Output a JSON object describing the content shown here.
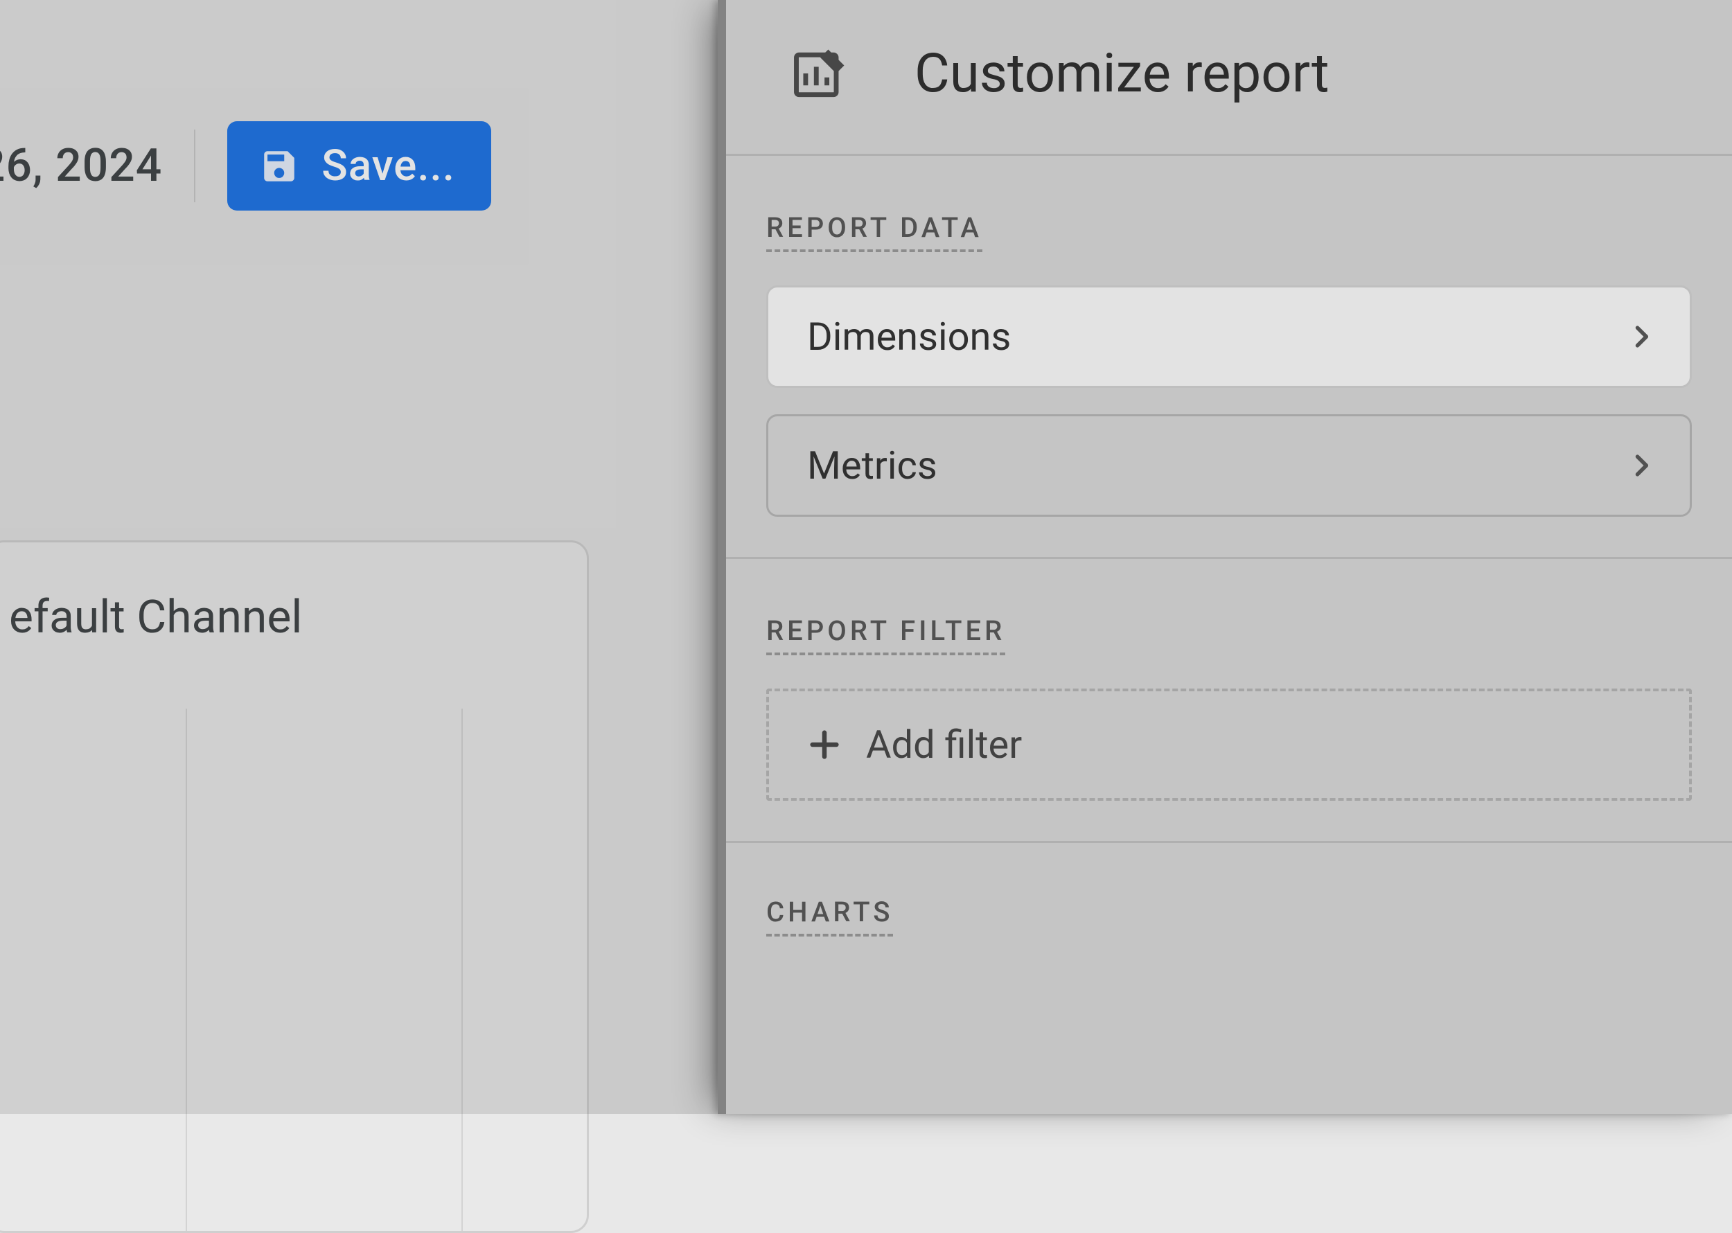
{
  "toolbar": {
    "date_fragment": "26, 2024",
    "save_label": "Save..."
  },
  "left_chart": {
    "title_fragment": "efault Channel"
  },
  "panel": {
    "title": "Customize report",
    "sections": {
      "report_data": {
        "label": "REPORT DATA",
        "items": [
          {
            "label": "Dimensions",
            "active": true
          },
          {
            "label": "Metrics",
            "active": false
          }
        ]
      },
      "report_filter": {
        "label": "REPORT FILTER",
        "add_label": "Add filter"
      },
      "charts": {
        "label": "CHARTS"
      }
    }
  }
}
